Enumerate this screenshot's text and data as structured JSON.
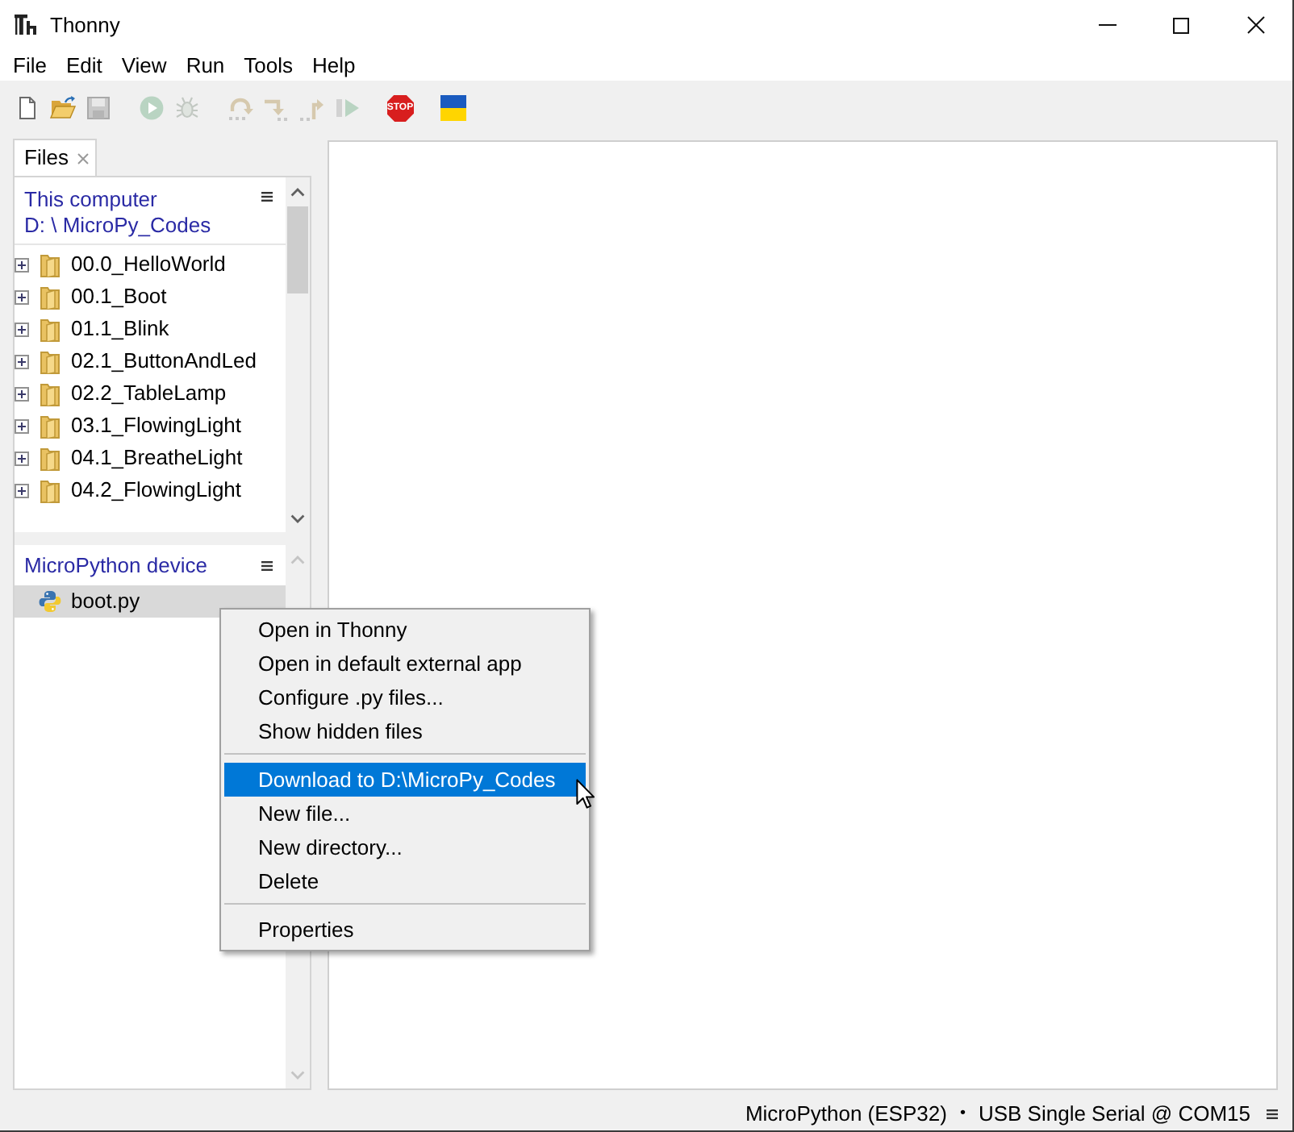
{
  "window": {
    "title": "Thonny"
  },
  "menu_bar": [
    "File",
    "Edit",
    "View",
    "Run",
    "Tools",
    "Help"
  ],
  "toolbar": {
    "groups": [
      {
        "buttons": [
          {
            "kind": "new",
            "disabled": false
          },
          {
            "kind": "open",
            "disabled": false
          },
          {
            "kind": "save",
            "disabled": true
          }
        ]
      },
      {
        "buttons": [
          {
            "kind": "run",
            "disabled": true
          },
          {
            "kind": "debug",
            "disabled": true
          }
        ]
      },
      {
        "buttons": [
          {
            "kind": "step_over",
            "disabled": true
          },
          {
            "kind": "step_into",
            "disabled": true
          },
          {
            "kind": "step_out",
            "disabled": true
          },
          {
            "kind": "resume",
            "disabled": true
          }
        ]
      },
      {
        "buttons": [
          {
            "kind": "stop",
            "disabled": false,
            "label": "STOP"
          }
        ]
      },
      {
        "buttons": [
          {
            "kind": "flag"
          }
        ]
      }
    ]
  },
  "side_tabs": [
    {
      "label": "Files",
      "selected": true
    }
  ],
  "files": {
    "local": {
      "title": "This computer",
      "path": "D: \\ MicroPy_Codes",
      "items": [
        {
          "name": "00.0_HelloWorld",
          "kind": "folder",
          "expanded": false,
          "selected": false
        },
        {
          "name": "00.1_Boot",
          "kind": "folder",
          "expanded": false,
          "selected": false
        },
        {
          "name": "01.1_Blink",
          "kind": "folder",
          "expanded": false,
          "selected": false
        },
        {
          "name": "02.1_ButtonAndLed",
          "kind": "folder",
          "expanded": false,
          "selected": false
        },
        {
          "name": "02.2_TableLamp",
          "kind": "folder",
          "expanded": false,
          "selected": false
        },
        {
          "name": "03.1_FlowingLight",
          "kind": "folder",
          "expanded": false,
          "selected": false
        },
        {
          "name": "04.1_BreatheLight",
          "kind": "folder",
          "expanded": false,
          "selected": false
        },
        {
          "name": "04.2_FlowingLight",
          "kind": "folder",
          "expanded": false,
          "selected": false
        }
      ]
    },
    "device": {
      "title": "MicroPython device",
      "items": [
        {
          "name": "boot.py",
          "kind": "python",
          "selected": true
        }
      ]
    }
  },
  "context_menu": {
    "items": [
      {
        "kind": "item",
        "label": "Open in Thonny",
        "selected": false
      },
      {
        "kind": "item",
        "label": "Open in default external app",
        "selected": false
      },
      {
        "kind": "item",
        "label": "Configure .py files...",
        "selected": false
      },
      {
        "kind": "item",
        "label": "Show hidden files",
        "selected": false
      },
      {
        "kind": "separator"
      },
      {
        "kind": "item",
        "label": "Download to D:\\MicroPy_Codes",
        "selected": true
      },
      {
        "kind": "item",
        "label": "New file...",
        "selected": false
      },
      {
        "kind": "item",
        "label": "New directory...",
        "selected": false
      },
      {
        "kind": "item",
        "label": "Delete",
        "selected": false
      },
      {
        "kind": "separator"
      },
      {
        "kind": "item",
        "label": "Properties",
        "selected": false
      }
    ]
  },
  "status_bar": {
    "interpreter": "MicroPython (ESP32)",
    "separator": "•",
    "port": "USB Single Serial @ COM15"
  }
}
